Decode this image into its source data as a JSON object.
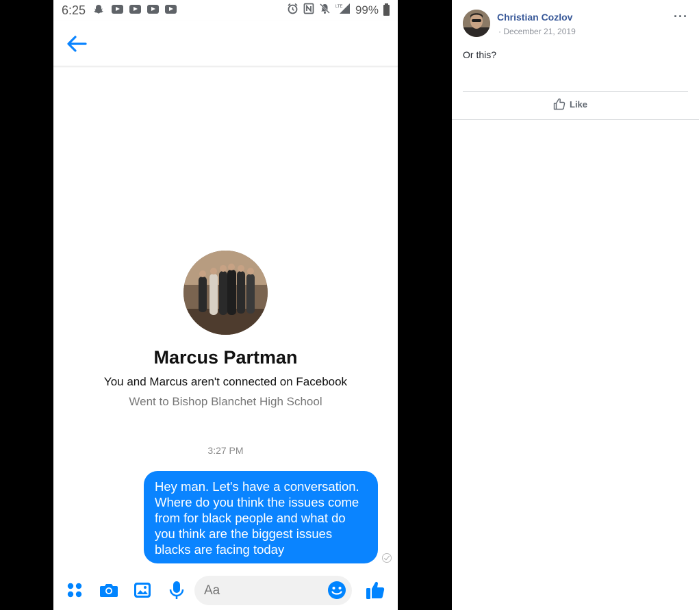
{
  "phone": {
    "status": {
      "time": "6:25",
      "battery": "99%",
      "icons_left": [
        "snapchat-icon",
        "youtube-icon",
        "youtube-icon",
        "youtube-icon",
        "youtube-icon"
      ],
      "icons_right": [
        "alarm-icon",
        "nfc-icon",
        "notifications-off-icon",
        "lte-signal-icon",
        "battery-icon"
      ]
    },
    "conversation": {
      "profile_name": "Marcus Partman",
      "connection_note": "You and Marcus aren't connected on Facebook",
      "school": "Went to Bishop Blanchet High School",
      "timestamp": "3:27 PM",
      "messages": [
        {
          "from": "me",
          "text": "Hey man. Let's have a conversation. Where do you think the issues come from for black people and what do you think are the biggest issues blacks are facing today"
        }
      ]
    },
    "composer": {
      "placeholder": "Aa"
    },
    "colors": {
      "accent": "#0a84ff",
      "icon_blue": "#0084ff"
    }
  },
  "fb_post": {
    "author": "Christian Cozlov",
    "date": "December 21, 2019",
    "text": "Or this?",
    "like_label": "Like",
    "more_label": "···",
    "colors": {
      "author": "#385898"
    }
  }
}
